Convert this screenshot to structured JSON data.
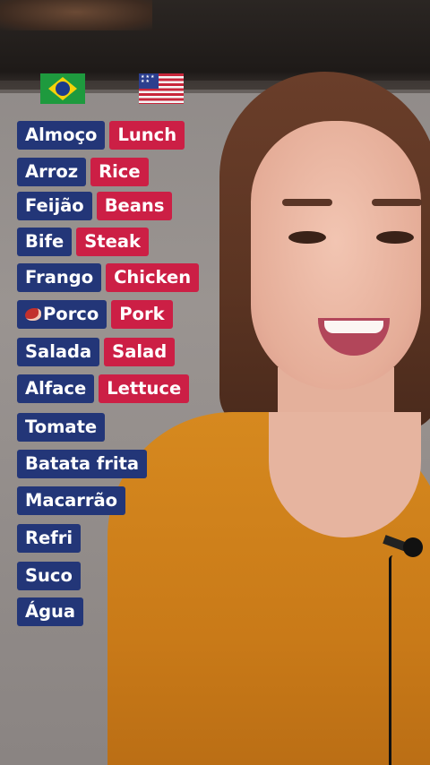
{
  "flags": {
    "portuguese": {
      "icon": "brazil-flag-icon"
    },
    "english": {
      "icon": "usa-flag-icon"
    }
  },
  "colors": {
    "portuguese_tag": "#233678",
    "english_tag": "#cc1f45",
    "shirt": "#d6891f"
  },
  "vocabulary": [
    {
      "pt": "Almoço",
      "en": "Lunch"
    },
    {
      "pt": "Arroz",
      "en": "Rice"
    },
    {
      "pt": "Feijão",
      "en": "Beans"
    },
    {
      "pt": "Bife",
      "en": "Steak"
    },
    {
      "pt": "Frango",
      "en": "Chicken"
    },
    {
      "pt": "Porco",
      "en": "Pork",
      "pt_icon": "meat-emoji-icon"
    },
    {
      "pt": "Salada",
      "en": "Salad"
    },
    {
      "pt": "Alface",
      "en": "Lettuce"
    },
    {
      "pt": "Tomate"
    },
    {
      "pt": "Batata frita"
    },
    {
      "pt": "Macarrão"
    },
    {
      "pt": "Refri"
    },
    {
      "pt": "Suco"
    },
    {
      "pt": "Água"
    }
  ]
}
